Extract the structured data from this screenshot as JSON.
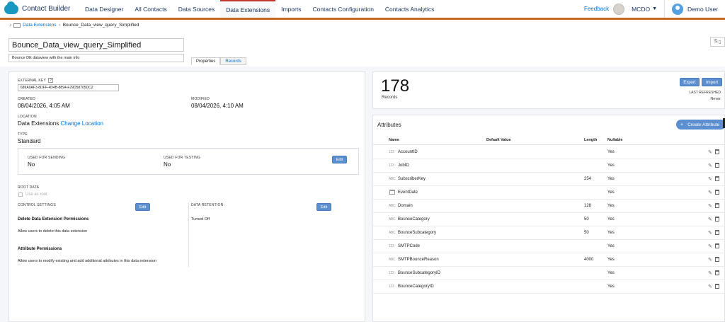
{
  "nav": {
    "brand": "Contact Builder",
    "tabs": [
      "Data Designer",
      "All Contacts",
      "Data Sources",
      "Data Extensions",
      "Imports",
      "Contacts Configuration",
      "Contacts Analytics"
    ],
    "active_tab": "Data Extensions",
    "feedback": "Feedback",
    "org": "MCDO",
    "user": "Demo User"
  },
  "breadcrumb": {
    "parent": "Data Extensions",
    "current": "Bounce_Data_view_query_Simplified"
  },
  "de": {
    "name": "Bounce_Data_view_query_Simplified",
    "description": "Bounce DE dataview with the main info",
    "subtabs": [
      "Properties",
      "Records"
    ]
  },
  "properties": {
    "external_key_label": "EXTERNAL KEY",
    "external_key_help": "?",
    "external_key": "689A9AF3-8DFF-4D4B-8894-F29D58705DC2",
    "created_label": "CREATED",
    "created": "08/04/2026, 4:05 AM",
    "modified_label": "MODIFIED",
    "modified": "08/04/2026, 4:10 AM",
    "location_label": "LOCATION",
    "location": "Data Extensions",
    "change_location": "Change Location",
    "type_label": "TYPE",
    "type": "Standard",
    "used_for_sending_label": "USED FOR SENDING",
    "used_for_sending": "No",
    "used_for_testing_label": "USED FOR TESTING",
    "used_for_testing": "No",
    "edit": "Edit",
    "root_data_label": "ROOT DATA",
    "use_as_root": "Use as root",
    "control_settings_label": "CONTROL SETTINGS",
    "data_retention_label": "DATA RETENTION",
    "data_retention": "Turned Off",
    "delete_perm_title": "Delete Data Extension Permissions",
    "delete_perm_text": "Allow users to delete this data extension",
    "attr_perm_title": "Attribute Permissions",
    "attr_perm_text": "Allow users to modify existing and add additional attributes in this data extension"
  },
  "records": {
    "count": "178",
    "count_label": "Records",
    "export": "Export",
    "import": "Import",
    "last_refreshed_label": "LAST REFRESHED",
    "last_refreshed": "Never"
  },
  "attributes": {
    "title": "Attributes",
    "create_button": "Create Attribute",
    "columns": [
      "Name",
      "Default Value",
      "Length",
      "Nullable"
    ],
    "rows": [
      {
        "type": "number",
        "name": "AccountID",
        "default": "",
        "length": "",
        "nullable": "Yes"
      },
      {
        "type": "number",
        "name": "JobID",
        "default": "",
        "length": "",
        "nullable": "Yes"
      },
      {
        "type": "text",
        "name": "SubscriberKey",
        "default": "",
        "length": "254",
        "nullable": "Yes"
      },
      {
        "type": "date",
        "name": "EventDate",
        "default": "",
        "length": "",
        "nullable": "Yes"
      },
      {
        "type": "text",
        "name": "Domain",
        "default": "",
        "length": "128",
        "nullable": "Yes"
      },
      {
        "type": "text",
        "name": "BounceCategory",
        "default": "",
        "length": "50",
        "nullable": "Yes"
      },
      {
        "type": "text",
        "name": "BounceSubcategory",
        "default": "",
        "length": "50",
        "nullable": "Yes"
      },
      {
        "type": "number",
        "name": "SMTPCode",
        "default": "",
        "length": "",
        "nullable": "Yes"
      },
      {
        "type": "text",
        "name": "SMTPBounceReason",
        "default": "",
        "length": "4000",
        "nullable": "Yes"
      },
      {
        "type": "number",
        "name": "BounceSubcategoryID",
        "default": "",
        "length": "",
        "nullable": "Yes"
      },
      {
        "type": "number",
        "name": "BounceCategoryID",
        "default": "",
        "length": "",
        "nullable": "Yes"
      }
    ]
  },
  "icons": {
    "number_glyph": "123",
    "text_glyph": "ABC",
    "pencil_glyph": "✎"
  }
}
